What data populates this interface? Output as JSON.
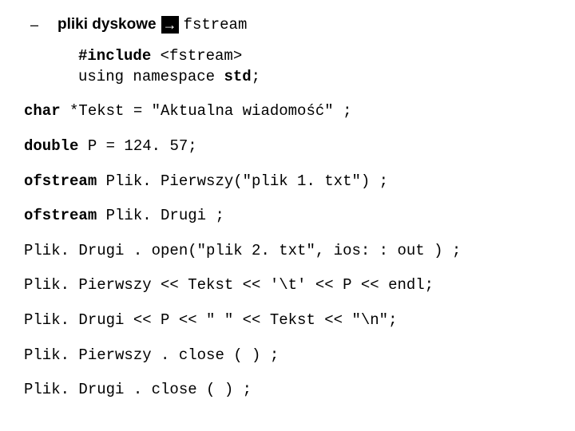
{
  "bullet": {
    "dash": "–",
    "label": "pliki dyskowe",
    "arrow_glyph": "→",
    "target": "fstream"
  },
  "include_block": {
    "line1_a": "#include",
    "line1_b": " <fstream>",
    "line2_a": "using namespace ",
    "line2_b": "std",
    "line2_c": ";"
  },
  "lines": {
    "l1_a": "char",
    "l1_b": "  *Tekst  =  \"Aktualna wiadomość\" ;",
    "l2_a": "double",
    "l2_b": " P = 124. 57;",
    "l3_a": "ofstream",
    "l3_b": " Plik. Pierwszy(\"plik 1. txt\") ;",
    "l4_a": "ofstream",
    "l4_b": "  Plik. Drugi ;",
    "l5": "Plik. Drugi . open(\"plik 2. txt\", ios: : out ) ;",
    "l6": "Plik. Pierwszy  <<  Tekst << '\\t' << P << endl;",
    "l7": "Plik. Drugi  <<  P << \"  \" << Tekst << \"\\n\";",
    "l8": "Plik. Pierwszy . close (  ) ;",
    "l9": "Plik. Drugi . close (  ) ;"
  }
}
